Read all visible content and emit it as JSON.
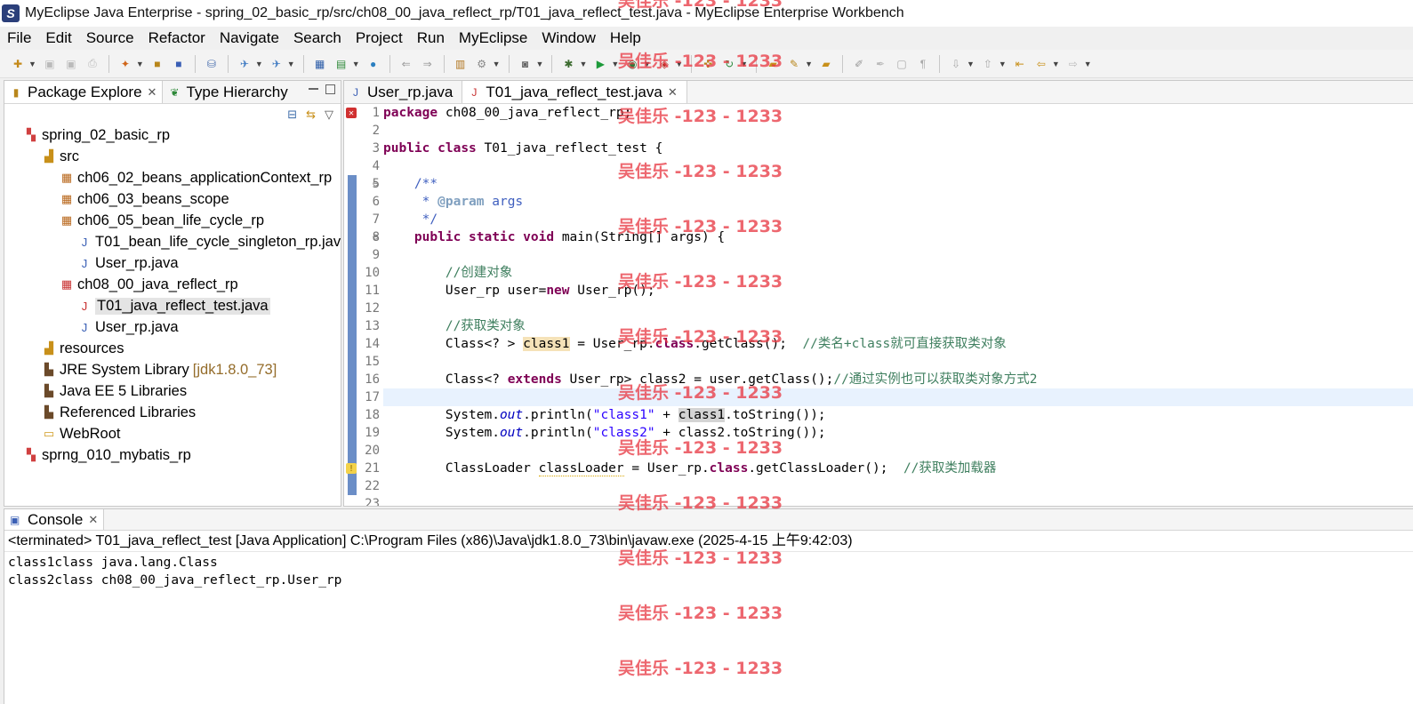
{
  "window": {
    "title": "MyEclipse Java Enterprise - spring_02_basic_rp/src/ch08_00_java_reflect_rp/T01_java_reflect_test.java - MyEclipse Enterprise Workbench"
  },
  "menu": [
    "File",
    "Edit",
    "Source",
    "Refactor",
    "Navigate",
    "Search",
    "Project",
    "Run",
    "MyEclipse",
    "Window",
    "Help"
  ],
  "package_explorer": {
    "tabs": [
      {
        "label": "Package Explore",
        "active": true
      },
      {
        "label": "Type Hierarchy",
        "active": false
      }
    ],
    "tree": [
      {
        "label": "spring_02_basic_rp",
        "icon": "project-icon",
        "level": 0
      },
      {
        "label": "src",
        "icon": "source-folder-icon",
        "level": 1
      },
      {
        "label": "ch06_02_beans_applicationContext_rp",
        "icon": "package-icon",
        "level": 2
      },
      {
        "label": "ch06_03_beans_scope",
        "icon": "package-icon",
        "level": 2
      },
      {
        "label": "ch06_05_bean_life_cycle_rp",
        "icon": "package-icon",
        "level": 2
      },
      {
        "label": "T01_bean_life_cycle_singleton_rp.java",
        "icon": "java-file-icon",
        "level": 3
      },
      {
        "label": "User_rp.java",
        "icon": "java-file-icon",
        "level": 3
      },
      {
        "label": "ch08_00_java_reflect_rp",
        "icon": "package-error-icon",
        "level": 2
      },
      {
        "label": "T01_java_reflect_test.java",
        "icon": "java-file-error-icon",
        "level": 3,
        "selected": true
      },
      {
        "label": "User_rp.java",
        "icon": "java-file-icon",
        "level": 3
      },
      {
        "label": "resources",
        "icon": "source-folder-icon",
        "level": 1
      },
      {
        "label": "JRE System Library",
        "secondary": "[jdk1.8.0_73]",
        "icon": "library-icon",
        "level": 1
      },
      {
        "label": "Java EE 5 Libraries",
        "icon": "library-icon",
        "level": 1
      },
      {
        "label": "Referenced Libraries",
        "icon": "library-icon",
        "level": 1
      },
      {
        "label": "WebRoot",
        "icon": "folder-icon",
        "level": 1
      },
      {
        "label": "sprng_010_mybatis_rp",
        "icon": "project-icon",
        "level": 0
      }
    ]
  },
  "editor": {
    "tabs": [
      {
        "label": "User_rp.java",
        "active": false
      },
      {
        "label": "T01_java_reflect_test.java",
        "active": true
      }
    ],
    "line_numbers": [
      "1",
      "2",
      "3",
      "4",
      "5",
      "6",
      "7",
      "8",
      "9",
      "10",
      "11",
      "12",
      "13",
      "14",
      "15",
      "16",
      "17",
      "18",
      "19",
      "20",
      "21",
      "22",
      "23"
    ]
  },
  "console": {
    "tab_label": "Console",
    "status": "<terminated> T01_java_reflect_test [Java Application] C:\\Program Files (x86)\\Java\\jdk1.8.0_73\\bin\\javaw.exe (2025-4-15 上午9:42:03)",
    "output": [
      "class1class java.lang.Class",
      "class2class ch08_00_java_reflect_rp.User_rp"
    ]
  },
  "watermark": "吴佳乐 -123 - 1233",
  "colors": {
    "keyword": "#7f0055",
    "comment": "#3f7f5f",
    "javadoc": "#3f5fbf",
    "string": "#2a00ff",
    "watermark": "#e83c46"
  }
}
